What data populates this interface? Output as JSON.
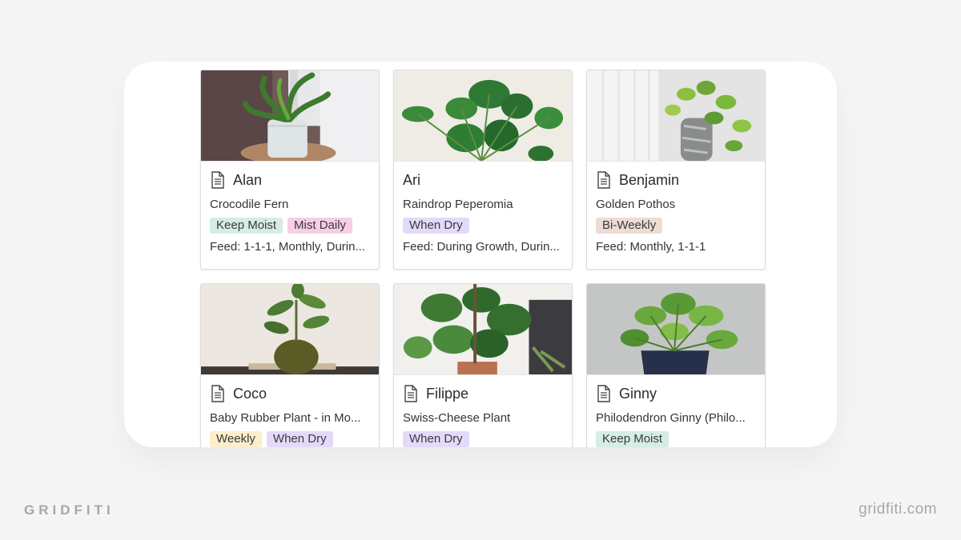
{
  "colors": {
    "tag_green": "#d6ece6",
    "tag_pink": "#f6cfe6",
    "tag_purple": "#e3dafa",
    "tag_brown": "#eddcd4",
    "tag_yellow": "#fbeecb"
  },
  "cards": [
    {
      "title": "Alan",
      "species": "Crocodile Fern",
      "tags": [
        {
          "label": "Keep Moist",
          "color": "#d6ece6"
        },
        {
          "label": "Mist Daily",
          "color": "#f6cfe6"
        }
      ],
      "feed": "Feed: 1-1-1, Monthly, Durin..."
    },
    {
      "title": "Ari",
      "species": "Raindrop Peperomia",
      "tags": [
        {
          "label": "When Dry",
          "color": "#e3dafa"
        }
      ],
      "feed": "Feed: During Growth, Durin..."
    },
    {
      "title": "Benjamin",
      "species": "Golden Pothos",
      "tags": [
        {
          "label": "Bi-Weekly",
          "color": "#eddcd4"
        }
      ],
      "feed": "Feed: Monthly, 1-1-1"
    },
    {
      "title": "Coco",
      "species": "Baby Rubber Plant - in Mo...",
      "tags": [
        {
          "label": "Weekly",
          "color": "#fbeecb"
        },
        {
          "label": "When Dry",
          "color": "#e3dafa"
        }
      ],
      "feed": ""
    },
    {
      "title": "Filippe",
      "species": "Swiss-Cheese Plant",
      "tags": [
        {
          "label": "When Dry",
          "color": "#e3dafa"
        }
      ],
      "feed": ""
    },
    {
      "title": "Ginny",
      "species": "Philodendron Ginny (Philo...",
      "tags": [
        {
          "label": "Keep Moist",
          "color": "#d6ece6"
        }
      ],
      "feed": ""
    }
  ],
  "branding": {
    "left": "GRIDFITI",
    "right": "gridfiti.com"
  },
  "icons": {
    "page": "page-icon"
  }
}
